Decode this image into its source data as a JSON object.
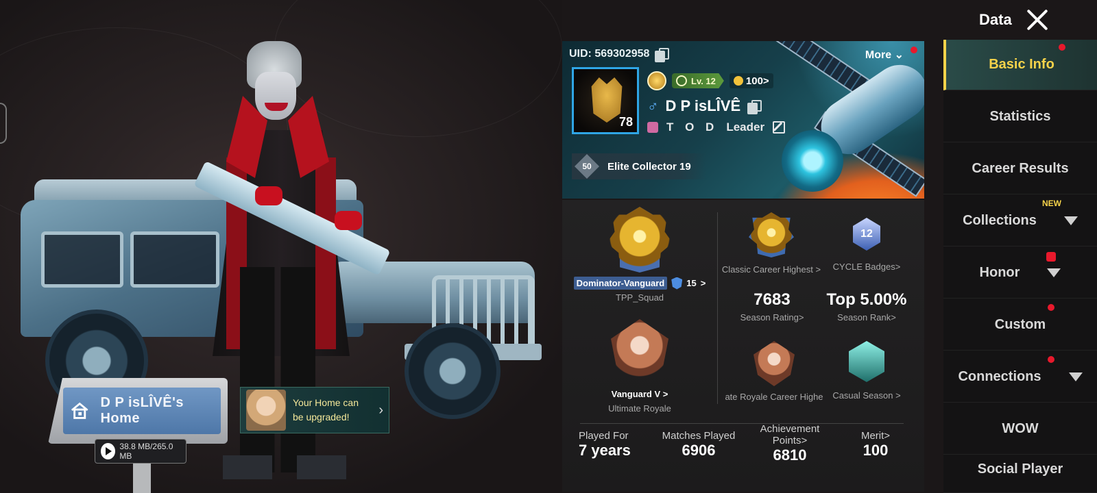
{
  "header": {
    "title": "Data",
    "close_icon": "close-icon"
  },
  "scene": {
    "home_sign": {
      "label": "D P  isLÎVÊ's Home",
      "icon": "home-icon"
    },
    "storage": {
      "text": "38.8 MB/265.0 MB",
      "icon": "play-icon"
    },
    "upgrade_toast": {
      "message": "Your Home can be upgraded!",
      "chevron": "›"
    }
  },
  "profile": {
    "uid": "UID: 569302958",
    "more": "More",
    "level_badge": "78",
    "level": "Lv. 12",
    "popularity": "100>",
    "name": "D P  isLÎVÊ",
    "gender_icon": "♂",
    "clan": "T O D",
    "role": "Leader",
    "collector": {
      "title": "Elite Collector 19",
      "badge": "50"
    }
  },
  "stats": {
    "dominator": {
      "rank": "Dominator-Vanguard",
      "stars": "15",
      "chevron": ">",
      "mode": "TPP_Squad"
    },
    "classic_highest": "Classic Career Highest >",
    "cycle": {
      "value": "12",
      "label": "CYCLE Badges>"
    },
    "season_rating": {
      "value": "7683",
      "label": "Season Rating>"
    },
    "season_rank": {
      "value": "Top 5.00%",
      "label": "Season Rank>"
    },
    "vanguard": {
      "rank": "Vanguard V >",
      "mode": "Ultimate Royale"
    },
    "ultimate_career": "ate Royale Career Highe",
    "casual_season": "Casual Season >",
    "played_for": {
      "label": "Played For",
      "value": "7 years"
    },
    "matches": {
      "label": "Matches Played",
      "value": "6906"
    },
    "achievement": {
      "label": "Achievement Points>",
      "value": "6810"
    },
    "merit": {
      "label": "Merit>",
      "value": "100"
    }
  },
  "sidebar": {
    "items": [
      {
        "label": "Basic Info"
      },
      {
        "label": "Statistics"
      },
      {
        "label": "Career Results"
      },
      {
        "label": "Collections",
        "tag": "NEW"
      },
      {
        "label": "Honor"
      },
      {
        "label": "Custom"
      },
      {
        "label": "Connections"
      },
      {
        "label": "WOW"
      },
      {
        "label": "Social Player"
      }
    ]
  },
  "colors": {
    "accent": "#f6d34a",
    "badge_red": "#e8192c",
    "panel": "#232223"
  }
}
